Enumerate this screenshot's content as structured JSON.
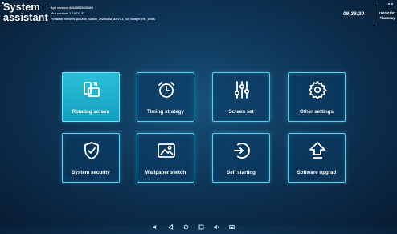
{
  "header": {
    "brand_line1": "System",
    "brand_line2": "assistant",
    "app_version": "App version:  AIO20B 20200409",
    "mcu_version": "Mcu version:  1.0.0712.31",
    "firmware_version": "Firmware version:  AIO20B_0386m_20200404_AI077.1_V2_Google_EN_10GB",
    "time": "09:36:30",
    "date": "1970/01/01",
    "weekday": "Thursday"
  },
  "tiles": [
    {
      "label": "Rotating screen",
      "icon": "rotate-screen-icon",
      "active": true
    },
    {
      "label": "Timing strategy",
      "icon": "alarm-clock-icon",
      "active": false
    },
    {
      "label": "Screen set",
      "icon": "sliders-icon",
      "active": false
    },
    {
      "label": "Other settings",
      "icon": "gear-icon",
      "active": false
    },
    {
      "label": "System security",
      "icon": "shield-check-icon",
      "active": false
    },
    {
      "label": "Wallpaper switch",
      "icon": "image-icon",
      "active": false
    },
    {
      "label": "Self starting",
      "icon": "power-arrow-icon",
      "active": false
    },
    {
      "label": "Software upgrad",
      "icon": "upload-arrow-icon",
      "active": false
    }
  ],
  "navbar": [
    "volume-down-icon",
    "back-icon",
    "home-icon",
    "recent-apps-icon",
    "volume-up-icon",
    "screenshot-icon"
  ],
  "colors": {
    "accent": "#4fd3f0",
    "active_tile": "#1aa9c8",
    "background": "#0e3658"
  }
}
